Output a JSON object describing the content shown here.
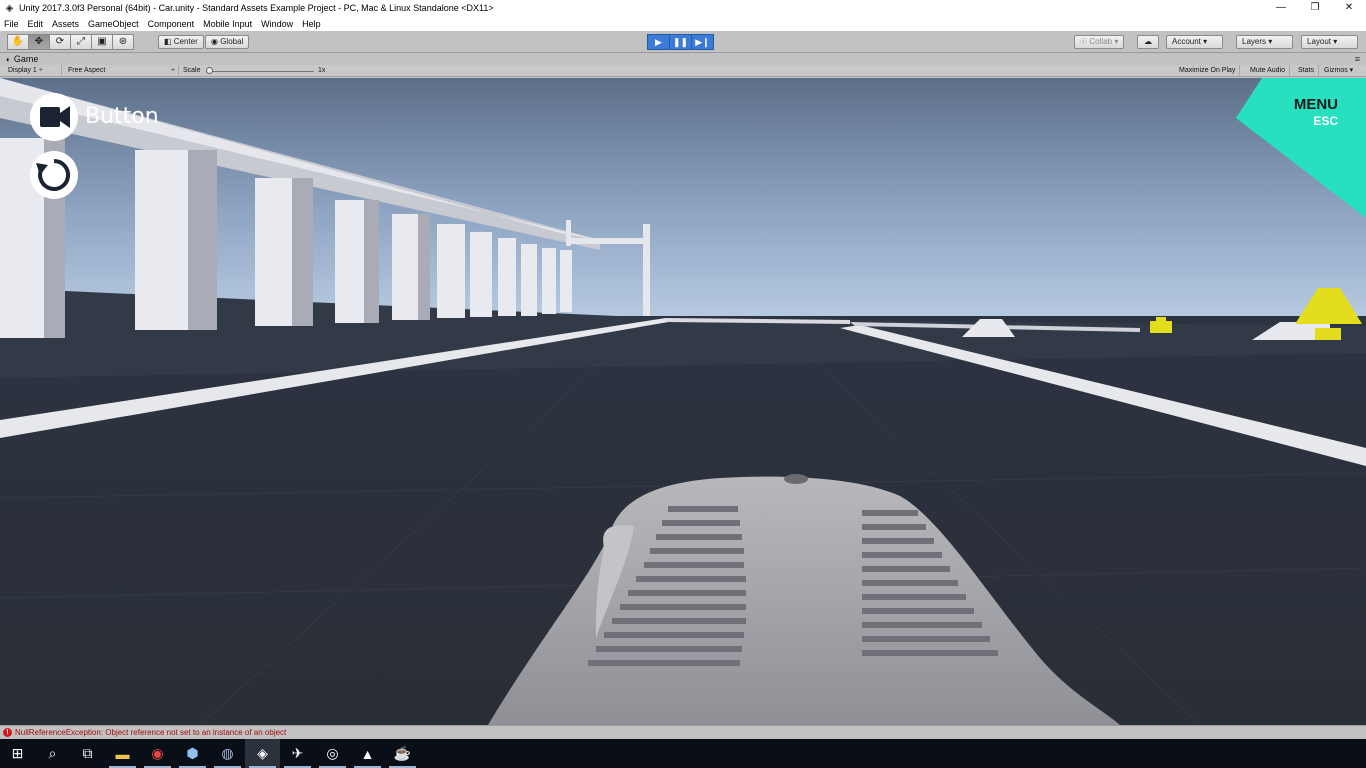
{
  "window": {
    "title": "Unity 2017.3.0f3 Personal (64bit) - Car.unity - Standard Assets Example Project - PC, Mac & Linux Standalone <DX11>",
    "controls": [
      "—",
      "❐",
      "✕"
    ]
  },
  "menubar": {
    "items": [
      "File",
      "Edit",
      "Assets",
      "GameObject",
      "Component",
      "Mobile Input",
      "Window",
      "Help"
    ]
  },
  "toolbar": {
    "pivot": "Center",
    "space": "Global",
    "collab": "Collab",
    "account": "Account",
    "layers": "Layers",
    "layout": "Layout",
    "tools": [
      "hand-tool",
      "move-tool",
      "rotate-tool",
      "scale-tool",
      "rect-tool",
      "transform-tool"
    ],
    "play_state": "playing"
  },
  "game_panel": {
    "tab": "Game",
    "display": "Display 1",
    "aspect": "Free Aspect",
    "scale_label": "Scale",
    "scale_value": "1x",
    "maximize_on_play": "Maximize On Play",
    "mute_audio": "Mute Audio",
    "stats": "Stats",
    "gizmos": "Gizmos"
  },
  "hud": {
    "camera_button_label": "Button",
    "menu_label": "MENU",
    "esc_label": "ESC",
    "accent_color": "#26e0c0"
  },
  "status": {
    "error": "NullReferenceException: Object reference not set to an instance of an object"
  },
  "taskbar": {
    "items": [
      "start-icon",
      "search-icon",
      "task-view-icon",
      "file-explorer-icon",
      "chrome-icon",
      "box-icon",
      "app-icon",
      "unity-icon",
      "bird-icon",
      "obs-icon",
      "photos-icon",
      "java-icon"
    ]
  }
}
